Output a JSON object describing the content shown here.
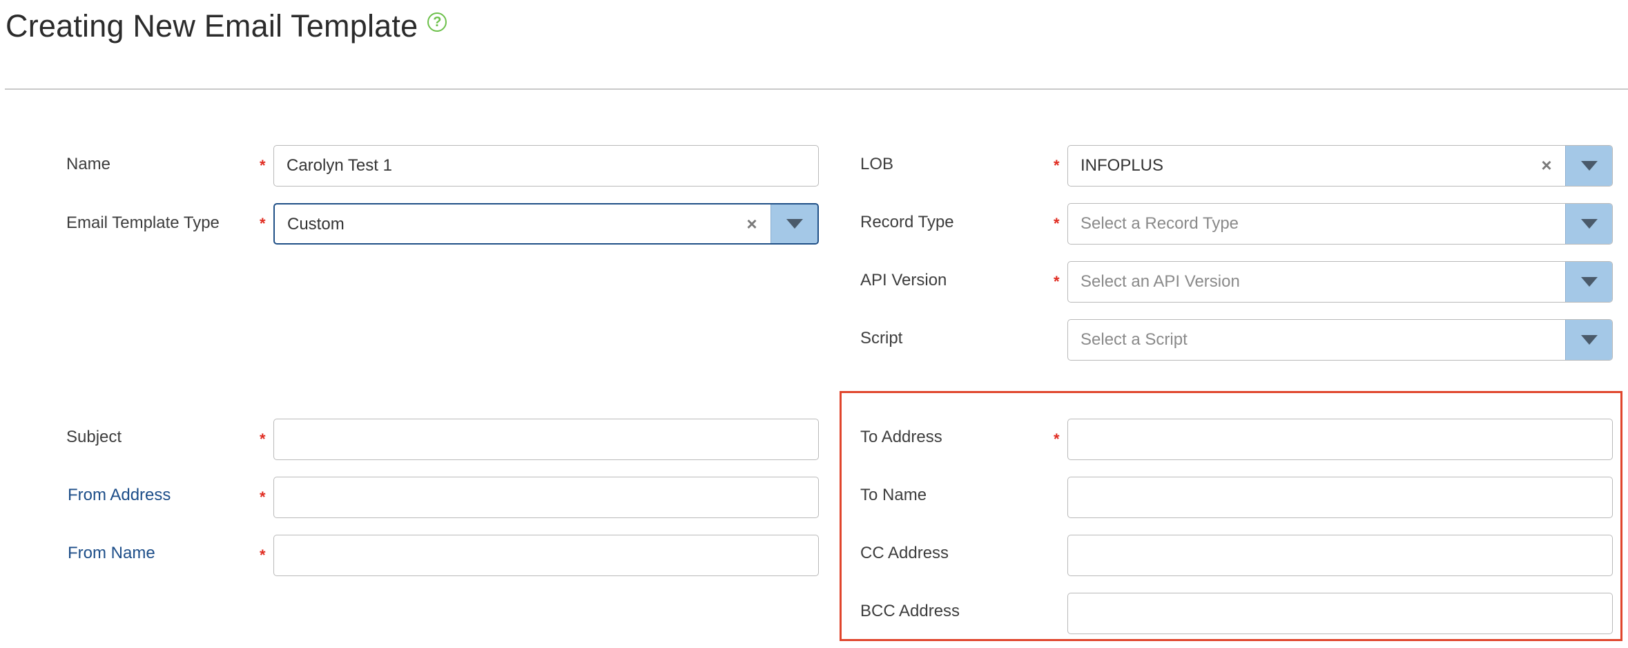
{
  "page": {
    "title": "Creating New Email Template",
    "help_icon": "question-circle-icon"
  },
  "colors": {
    "required": "#e02b20",
    "link": "#1d4e89",
    "dropdown_button": "#a4c8e7",
    "highlight_border": "#e0452c",
    "help_icon": "#6cc04a"
  },
  "left": {
    "name": {
      "label": "Name",
      "value": "Carolyn Test 1",
      "required": true
    },
    "email_template_type": {
      "label": "Email Template Type",
      "value": "Custom",
      "required": true,
      "clear_symbol": "×"
    },
    "subject": {
      "label": "Subject",
      "value": "",
      "required": true
    },
    "from_address": {
      "label": "From Address",
      "value": "",
      "required": true
    },
    "from_name": {
      "label": "From Name",
      "value": "",
      "required": true
    }
  },
  "right": {
    "lob": {
      "label": "LOB",
      "value": "INFOPLUS",
      "required": true,
      "clear_symbol": "×"
    },
    "record_type": {
      "label": "Record Type",
      "placeholder": "Select a Record Type",
      "required": true
    },
    "api_version": {
      "label": "API Version",
      "placeholder": "Select an API Version",
      "required": true
    },
    "script": {
      "label": "Script",
      "placeholder": "Select a Script",
      "required": false
    },
    "to_address": {
      "label": "To Address",
      "value": "",
      "required": true
    },
    "to_name": {
      "label": "To Name",
      "value": ""
    },
    "cc_address": {
      "label": "CC Address",
      "value": ""
    },
    "bcc_address": {
      "label": "BCC Address",
      "value": ""
    }
  },
  "required_marker": "*"
}
